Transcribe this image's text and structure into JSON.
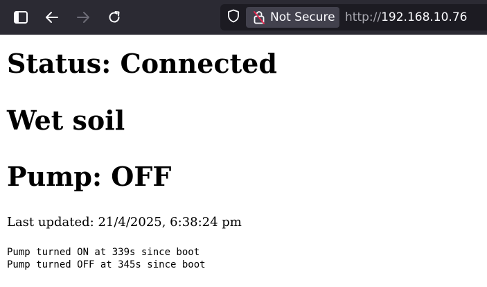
{
  "browser": {
    "security_label": "Not Secure",
    "url_protocol": "http://",
    "url_host": "192.168.10.76",
    "icons": {
      "sidebar": "sidebar-toggle-icon",
      "back": "arrow-left-icon",
      "forward": "arrow-right-icon",
      "reload": "reload-icon",
      "shield": "shield-icon",
      "lock": "insecure-lock-icon"
    },
    "colors": {
      "toolbar_bg": "#2b2a33",
      "urlbar_bg": "#1c1b22",
      "insecure_accent": "#e22850"
    }
  },
  "page": {
    "status_heading": "Status: Connected",
    "soil_heading": "Wet soil",
    "pump_heading": "Pump: OFF",
    "last_updated": "Last updated: 21/4/2025, 6:38:24 pm",
    "log": [
      "Pump turned ON at 339s since boot",
      "Pump turned OFF at 345s since boot"
    ]
  }
}
